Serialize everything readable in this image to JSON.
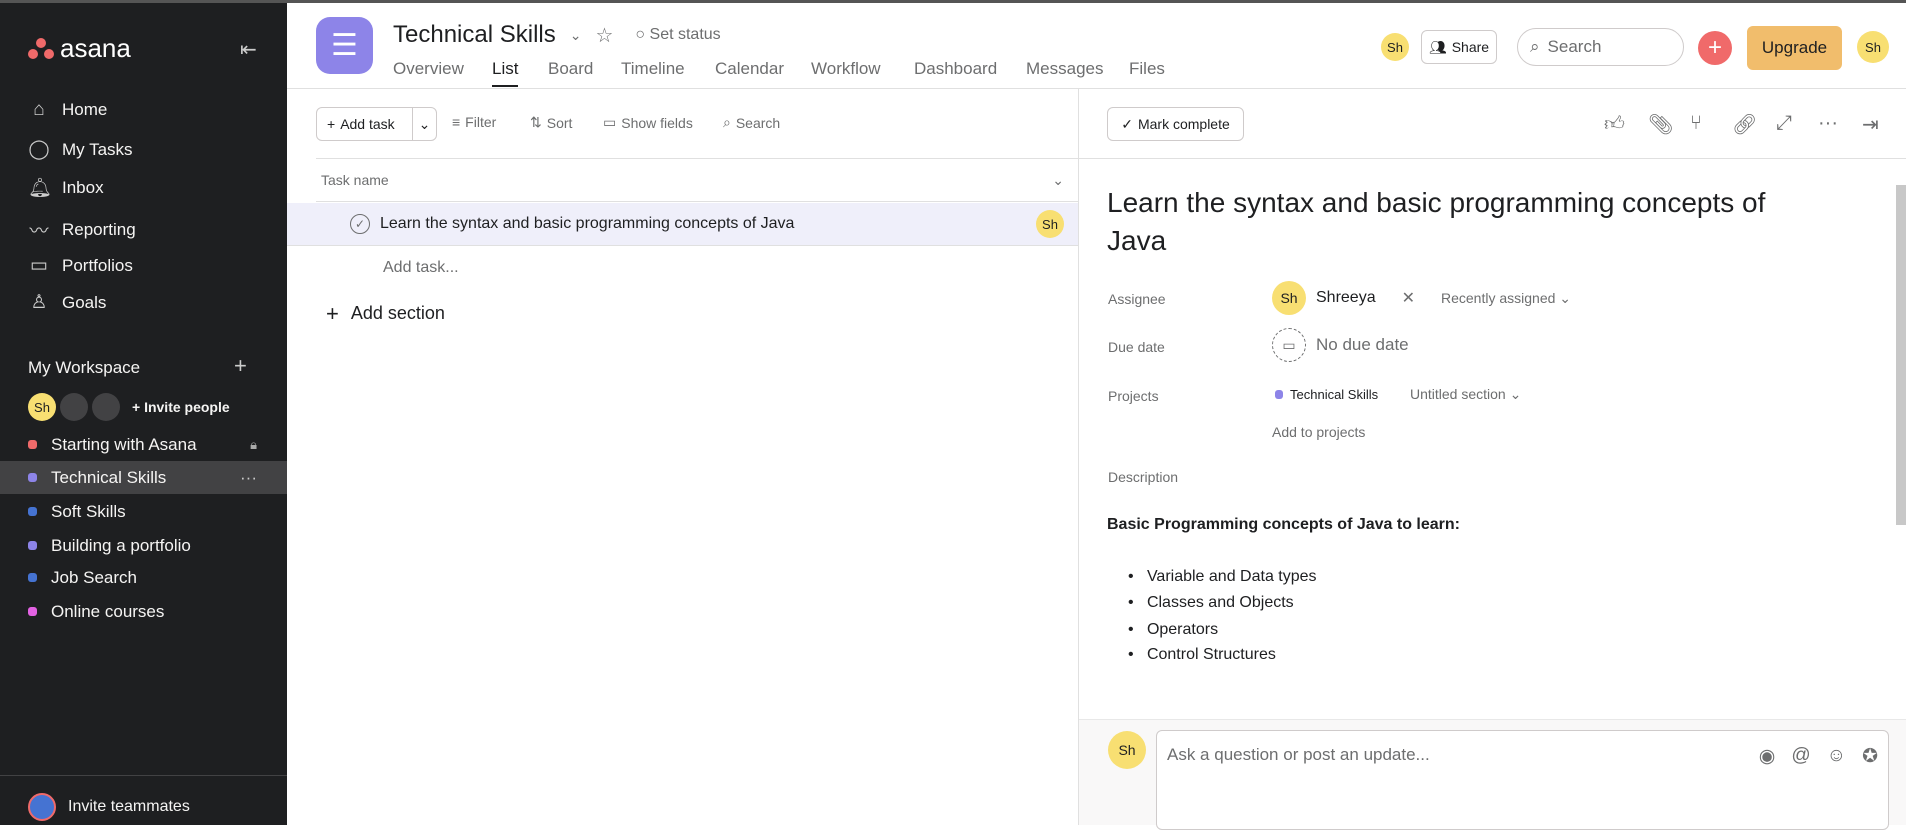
{
  "app": {
    "logo": "asana"
  },
  "sidebar": {
    "nav": [
      {
        "label": "Home",
        "icon": "home-icon"
      },
      {
        "label": "My Tasks",
        "icon": "check-circle-icon"
      },
      {
        "label": "Inbox",
        "icon": "bell-icon"
      },
      {
        "label": "Reporting",
        "icon": "chart-icon"
      },
      {
        "label": "Portfolios",
        "icon": "folder-icon"
      },
      {
        "label": "Goals",
        "icon": "person-icon"
      }
    ],
    "workspace": "My Workspace",
    "member_initials": "Sh",
    "invite_people": "Invite people",
    "projects": [
      {
        "label": "Starting with Asana",
        "color": "#f06a6a"
      },
      {
        "label": "Technical Skills",
        "color": "#8d84e8"
      },
      {
        "label": "Soft Skills",
        "color": "#4573d2"
      },
      {
        "label": "Building a portfolio",
        "color": "#8d84e8"
      },
      {
        "label": "Job Search",
        "color": "#4573d2"
      },
      {
        "label": "Online courses",
        "color": "#e362e3"
      }
    ],
    "invite_teammates": "Invite teammates"
  },
  "header": {
    "title": "Technical Skills",
    "set_status": "Set status",
    "tabs": [
      "Overview",
      "List",
      "Board",
      "Timeline",
      "Calendar",
      "Workflow",
      "Dashboard",
      "Messages",
      "Files"
    ],
    "user_initials": "Sh",
    "share": "Share",
    "search_placeholder": "Search",
    "upgrade": "Upgrade"
  },
  "toolbar": {
    "add_task": "Add task",
    "filter": "Filter",
    "sort": "Sort",
    "show_fields": "Show fields",
    "search": "Search"
  },
  "list": {
    "column": "Task name",
    "tasks": [
      {
        "name": "Learn the syntax and basic programming concepts of Java",
        "assignee": "Sh"
      }
    ],
    "add_task": "Add task...",
    "add_section": "Add section"
  },
  "detail": {
    "mark_complete": "Mark complete",
    "title": "Learn the syntax and basic programming concepts of Java",
    "assignee_label": "Assignee",
    "assignee_initials": "Sh",
    "assignee": "Shreeya",
    "recently_assigned": "Recently assigned",
    "due_label": "Due date",
    "due": "No due date",
    "projects_label": "Projects",
    "project": "Technical Skills",
    "section": "Untitled section",
    "add_to_projects": "Add to projects",
    "description_label": "Description",
    "description_heading": "Basic Programming concepts of Java to learn:",
    "bullets": [
      "Variable and Data types",
      "Classes and Objects",
      "Operators",
      "Control Structures"
    ],
    "comment_initials": "Sh",
    "comment_placeholder": "Ask a question or post an update..."
  }
}
